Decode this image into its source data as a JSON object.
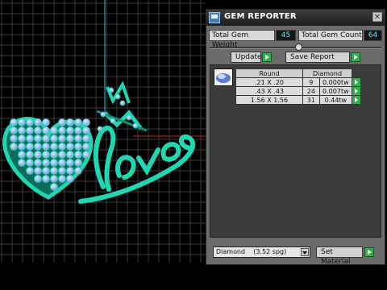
{
  "panel": {
    "title": "GEM REPORTER",
    "close_glyph": "✕",
    "total_weight_label": "Total Gem Weight",
    "total_weight_value": "45",
    "total_count_label": "Total Gem Count",
    "total_count_value": "64",
    "update_label": "Update",
    "save_report_label": "Save Report",
    "table": {
      "headers": [
        "Round",
        "Diamond"
      ],
      "rows": [
        {
          "size": ".21 X .20",
          "count": "9",
          "weight": "0.000tw"
        },
        {
          "size": ".43 X .43",
          "count": "24",
          "weight": "0.007tw"
        },
        {
          "size": "1.56 X 1.56",
          "count": "31",
          "weight": "0.44tw"
        }
      ]
    },
    "material_select": "Diamond    (3.52 spg)",
    "set_material_label": "Set Material"
  },
  "icons": {
    "app": "gem-reporter-icon",
    "close": "close-icon",
    "go": "play-arrow-icon",
    "gem_thumb": "round-gem-icon",
    "dropdown": "chevron-down-icon"
  },
  "colors": {
    "viewport_bg": "#000000",
    "grid": "#3a3a3a",
    "jewel_body": "#18c6a2",
    "gem": "#9fc8ff",
    "accent_go": "#2fb04a",
    "value_text": "#5fe8ff"
  }
}
